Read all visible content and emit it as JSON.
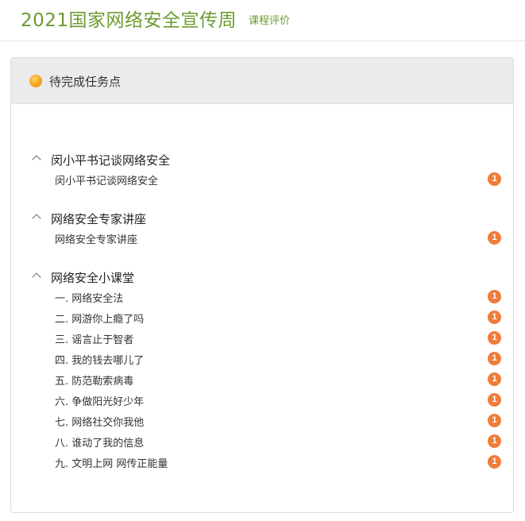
{
  "header": {
    "title": "2021国家网络安全宣传周",
    "eval_link": "课程评价"
  },
  "panel": {
    "title": "待完成任务点",
    "icon": "orange-dot-icon"
  },
  "chapters": [
    {
      "title": "闵小平书记谈网络安全",
      "items": [
        {
          "label": "闵小平书记谈网络安全",
          "badge": "1"
        }
      ]
    },
    {
      "title": "网络安全专家讲座",
      "items": [
        {
          "label": "网络安全专家讲座",
          "badge": "1"
        }
      ]
    },
    {
      "title": "网络安全小课堂",
      "items": [
        {
          "label": "一. 网络安全法",
          "badge": "1"
        },
        {
          "label": "二. 网游你上瘾了吗",
          "badge": "1"
        },
        {
          "label": "三. 谣言止于智者",
          "badge": "1"
        },
        {
          "label": "四. 我的钱去哪儿了",
          "badge": "1"
        },
        {
          "label": "五. 防范勒索病毒",
          "badge": "1"
        },
        {
          "label": "六. 争做阳光好少年",
          "badge": "1"
        },
        {
          "label": "七. 网络社交你我他",
          "badge": "1"
        },
        {
          "label": "八. 谁动了我的信息",
          "badge": "1"
        },
        {
          "label": "九. 文明上网 网传正能量",
          "badge": "1"
        }
      ]
    }
  ],
  "colors": {
    "accent_green": "#6d9a2e",
    "badge_orange": "#f07c3a"
  }
}
